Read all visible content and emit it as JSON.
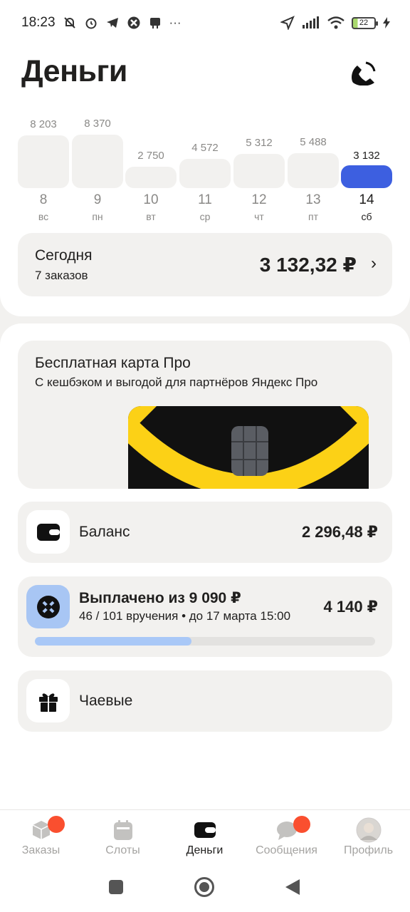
{
  "status_bar": {
    "time": "18:23",
    "extra": "···",
    "battery": "22"
  },
  "header": {
    "title": "Деньги"
  },
  "earnings_chart": {
    "bars": [
      {
        "value": "8 203",
        "day": "8",
        "dow": "вс",
        "active": false
      },
      {
        "value": "8 370",
        "day": "9",
        "dow": "пн",
        "active": false
      },
      {
        "value": "2 750",
        "day": "10",
        "dow": "вт",
        "active": false
      },
      {
        "value": "4 572",
        "day": "11",
        "dow": "ср",
        "active": false
      },
      {
        "value": "5 312",
        "day": "12",
        "dow": "чт",
        "active": false
      },
      {
        "value": "5 488",
        "day": "13",
        "dow": "пт",
        "active": false
      },
      {
        "value": "3 132",
        "day": "14",
        "dow": "сб",
        "active": true
      }
    ]
  },
  "today": {
    "title": "Сегодня",
    "orders": "7 заказов",
    "amount": "3 132,32 ₽",
    "chevron": "›"
  },
  "promo": {
    "title": "Бесплатная карта Про",
    "subtitle": "С кешбэком и выгодой для партнёров Яндекс Про"
  },
  "balance": {
    "label": "Баланс",
    "amount": "2 296,48 ₽",
    "icon": "wallet-icon"
  },
  "payout": {
    "title": "Выплачено из 9 090 ₽",
    "subtitle": "46 / 101 вручения • до 17 марта 15:00",
    "amount": "4 140 ₽",
    "progress": 0.46,
    "icon": "x-circle-icon"
  },
  "tips": {
    "label": "Чаевые",
    "icon": "gift-icon"
  },
  "bottom_nav": {
    "items": [
      {
        "label": "Заказы",
        "badge": true,
        "active": false
      },
      {
        "label": "Слоты",
        "badge": false,
        "active": false
      },
      {
        "label": "Деньги",
        "badge": false,
        "active": true
      },
      {
        "label": "Сообщения",
        "badge": true,
        "active": false
      },
      {
        "label": "Профиль",
        "badge": false,
        "active": false
      }
    ]
  },
  "colors": {
    "accent": "#3d5fe0",
    "badge": "#fa4f2f",
    "yellow": "#fcd116",
    "progress": "#a9c8f7"
  }
}
